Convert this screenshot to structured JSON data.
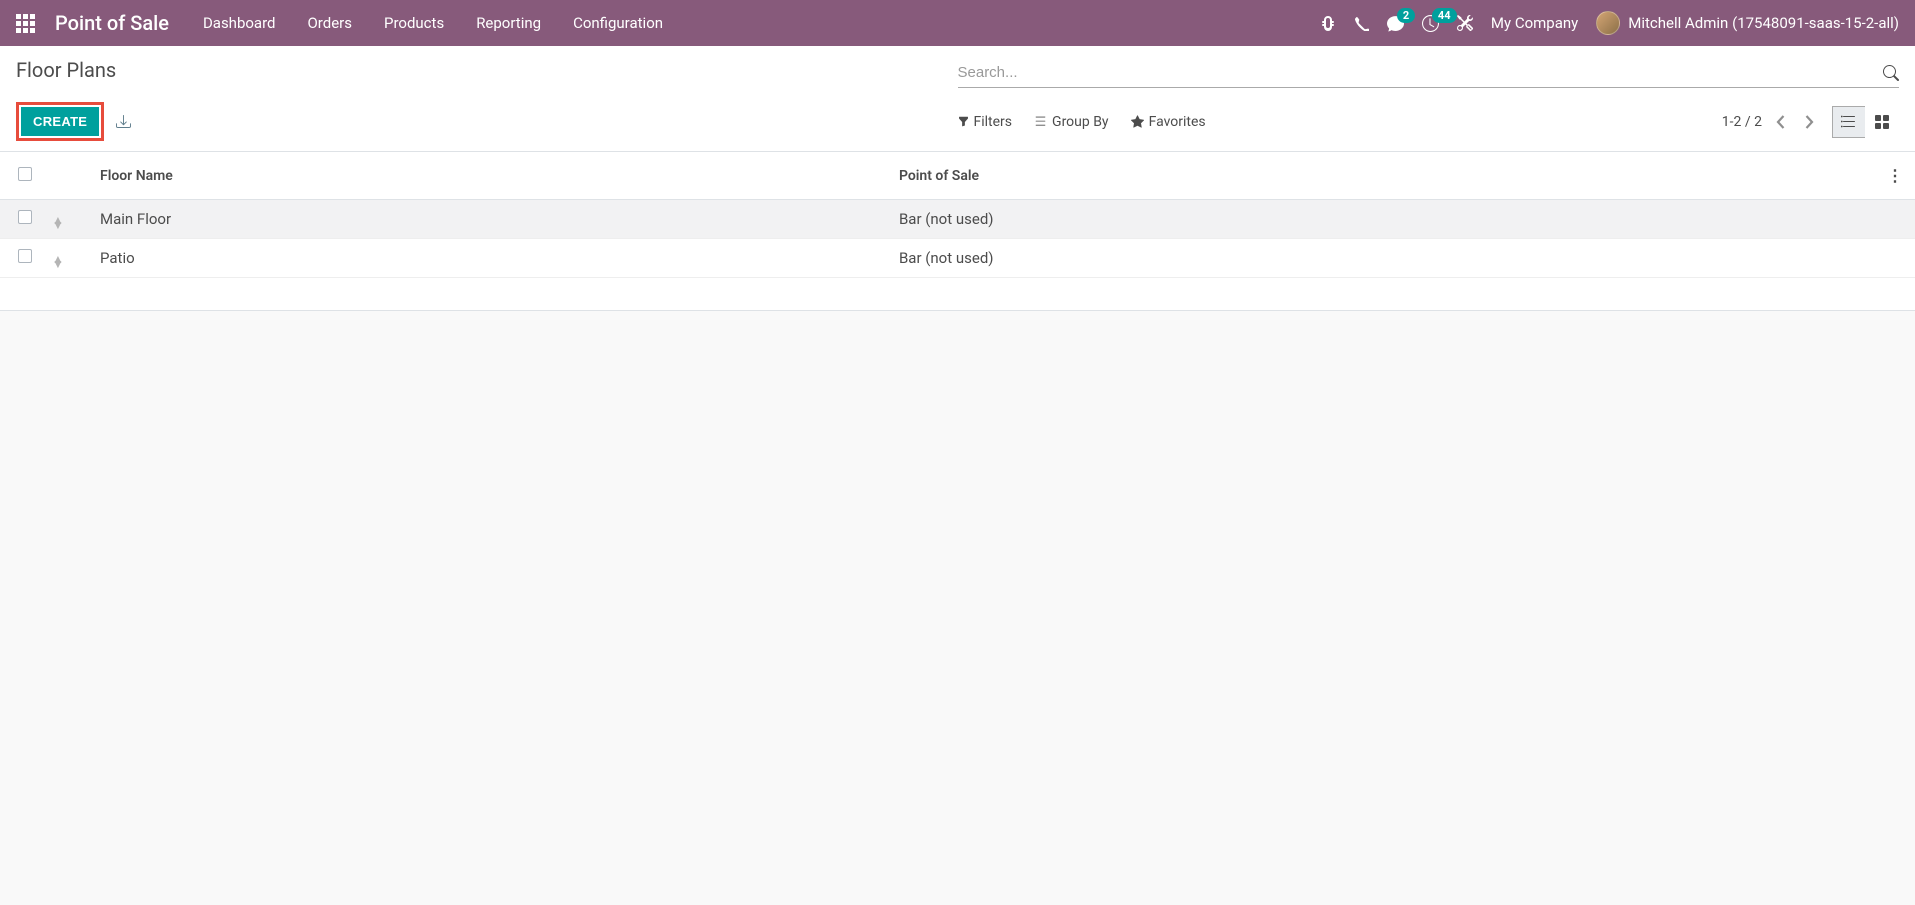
{
  "navbar": {
    "app_title": "Point of Sale",
    "menu": [
      "Dashboard",
      "Orders",
      "Products",
      "Reporting",
      "Configuration"
    ],
    "messages_badge": "2",
    "activities_badge": "44",
    "company": "My Company",
    "user": "Mitchell Admin (17548091-saas-15-2-all)"
  },
  "control_panel": {
    "breadcrumb": "Floor Plans",
    "search_placeholder": "Search...",
    "create_label": "Create",
    "filters_label": "Filters",
    "groupby_label": "Group By",
    "favorites_label": "Favorites",
    "pager": "1-2 / 2"
  },
  "table": {
    "columns": {
      "floor_name": "Floor Name",
      "pos": "Point of Sale"
    },
    "rows": [
      {
        "floor_name": "Main Floor",
        "pos": "Bar (not used)"
      },
      {
        "floor_name": "Patio",
        "pos": "Bar (not used)"
      }
    ]
  }
}
